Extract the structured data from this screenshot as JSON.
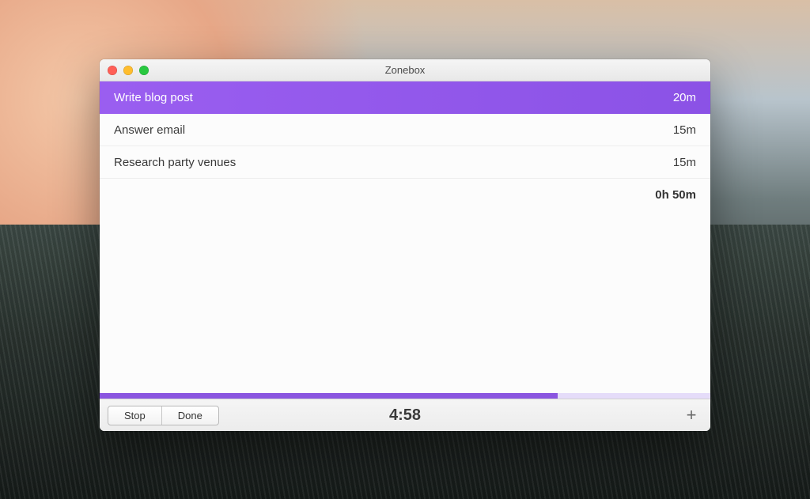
{
  "window": {
    "title": "Zonebox"
  },
  "tasks": [
    {
      "name": "Write blog post",
      "duration": "20m",
      "active": true
    },
    {
      "name": "Answer email",
      "duration": "15m",
      "active": false
    },
    {
      "name": "Research party venues",
      "duration": "15m",
      "active": false
    }
  ],
  "summary": {
    "total": "0h 50m"
  },
  "progress": {
    "percent": 75
  },
  "toolbar": {
    "stop_label": "Stop",
    "done_label": "Done",
    "timer": "4:58",
    "add_glyph": "+"
  },
  "accent_color": "#8a55e0"
}
